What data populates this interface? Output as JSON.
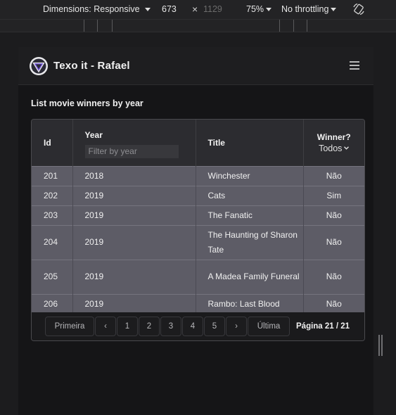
{
  "devtools": {
    "dimensions_label": "Dimensions: Responsive",
    "width": "673",
    "height": "1129",
    "times": "×",
    "zoom": "75%",
    "throttling": "No throttling",
    "rotate_icon": "rotate-icon"
  },
  "app": {
    "brand": "Texo it - Rafael",
    "section_title": "List movie winners by year"
  },
  "table": {
    "headers": {
      "id": "Id",
      "year": "Year",
      "title": "Title",
      "winner": "Winner?",
      "winner_filter": "Todos"
    },
    "year_filter_placeholder": "Filter by year",
    "rows": [
      {
        "id": "201",
        "year": "2018",
        "title": "Winchester",
        "winner": "Não"
      },
      {
        "id": "202",
        "year": "2019",
        "title": "Cats",
        "winner": "Sim"
      },
      {
        "id": "203",
        "year": "2019",
        "title": "The Fanatic",
        "winner": "Não"
      },
      {
        "id": "204",
        "year": "2019",
        "title": "The Haunting of Sharon Tate",
        "winner": "Não"
      },
      {
        "id": "205",
        "year": "2019",
        "title": "A Madea Family Funeral",
        "winner": "Não"
      },
      {
        "id": "206",
        "year": "2019",
        "title": "Rambo: Last Blood",
        "winner": "Não"
      }
    ]
  },
  "pagination": {
    "first": "Primeira",
    "prev": "‹",
    "pages": [
      "1",
      "2",
      "3",
      "4",
      "5"
    ],
    "next": "›",
    "last": "Última",
    "info": "Página 21 / 21"
  },
  "colors": {
    "row_bg": "#5d5c66",
    "header_bg": "#2c2c30",
    "page_bg": "#151517"
  }
}
